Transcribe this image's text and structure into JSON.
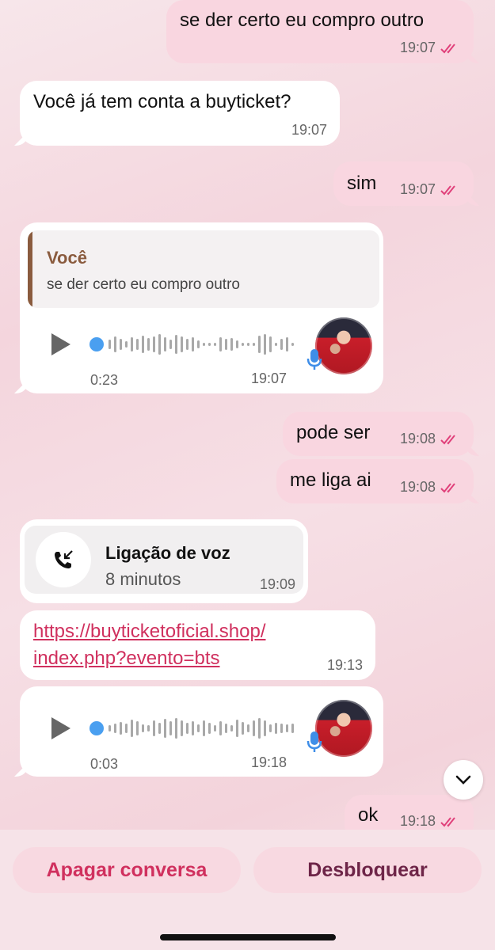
{
  "messages": {
    "m1": {
      "text": "se der certo eu compro outro",
      "time": "19:07"
    },
    "m2": {
      "text": "Você já tem conta a buyticket?",
      "time": "19:07"
    },
    "m3": {
      "text": "sim",
      "time": "19:07"
    },
    "voice1": {
      "reply_author": "Você",
      "reply_text": "se der certo eu compro outro",
      "duration": "0:23",
      "time": "19:07"
    },
    "m4": {
      "text": "pode ser",
      "time": "19:08"
    },
    "m5": {
      "text": "me liga ai",
      "time": "19:08"
    },
    "call": {
      "title": "Ligação de voz",
      "subtitle": "8 minutos",
      "time": "19:09"
    },
    "link": {
      "line1": "https://buyticketoficial.shop/",
      "line2": "index.php?evento=bts",
      "time": "19:13"
    },
    "voice2": {
      "duration": "0:03",
      "time": "19:18"
    },
    "m6": {
      "text": "ok",
      "time": "19:18"
    }
  },
  "actions": {
    "delete_label": "Apagar conversa",
    "unblock_label": "Desbloquear"
  },
  "colors": {
    "outgoing_bubble": "#f9d6e0",
    "incoming_bubble": "#ffffff",
    "read_ticks": "#e0407a",
    "accent_red": "#d0305e",
    "reply_author": "#8a5b3e",
    "voice_dot": "#4a9ff0"
  },
  "icons": {
    "ticks": "double-check-icon",
    "play": "play-icon",
    "mic": "microphone-icon",
    "call": "incoming-call-icon",
    "scroll": "chevron-down-icon"
  }
}
